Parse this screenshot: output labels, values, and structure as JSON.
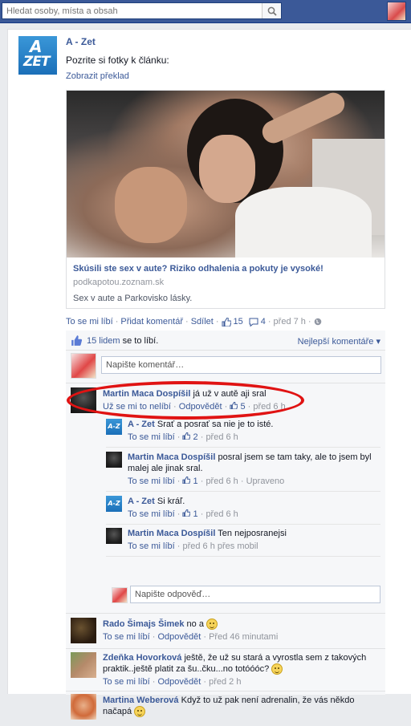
{
  "topbar": {
    "search_placeholder": "Hledat osoby, místa a obsah",
    "search_icon": "search-icon",
    "profile_avatar": "profile-avatar"
  },
  "post": {
    "author": "A - Zet",
    "logo_letter_top": "A",
    "logo_letter_bottom": "ZET",
    "text": "Pozrite si fotky k článku:",
    "translate": "Zobrazit překlad",
    "share": {
      "title": "Skúsili ste sex v aute? Riziko odhalenia a pokuty je vysoké!",
      "domain": "podkapotou.zoznam.sk",
      "description": "Sex v aute a Parkovisko lásky."
    },
    "actions": {
      "like": "To se mi líbí",
      "comment": "Přidat komentář",
      "share": "Sdílet",
      "like_count": "15",
      "comment_count": "4",
      "time": "před 7 h"
    }
  },
  "ufi": {
    "likes_text_link": "15 lidem",
    "likes_text_rest": " se to líbí.",
    "sort": "Nejlepší komentáře ▾",
    "comment_placeholder": "Napište komentář…",
    "reply_placeholder": "Napište odpověď…",
    "comments": [
      {
        "name": "Martin Maca Dospíšil",
        "text": " já už v autě aji sral",
        "meta_unlike": "Už se mi to nelíbí",
        "meta_reply": "Odpovědět",
        "likes": "5",
        "time": "před 6 h",
        "replies": [
          {
            "name": "A - Zet",
            "text": " Srať a posrať sa nie je to isté.",
            "like": "To se mi líbí",
            "likes": "2",
            "time": "před 6 h"
          },
          {
            "name": "Martin Maca Dospíšil",
            "text": " posral jsem se tam taky, ale to jsem byl malej ale jinak sral.",
            "like": "To se mi líbí",
            "likes": "1",
            "time": "před 6 h",
            "extra": "Upraveno"
          },
          {
            "name": "A - Zet",
            "text": " Si kráľ.",
            "like": "To se mi líbí",
            "likes": "1",
            "time": "před 6 h"
          },
          {
            "name": "Martin Maca Dospíšil",
            "text": " Ten nejposranejsi",
            "like": "To se mi líbí",
            "time": "před 6 h přes mobil"
          }
        ]
      },
      {
        "name": "Rado Šimajs Šimek",
        "text": " no a",
        "like": "To se mi líbí",
        "reply": "Odpovědět",
        "time": "Před 46 minutami"
      },
      {
        "name": "Zdeňka Hovorková",
        "text": " ještě, že už su stará a vyrostla sem z takových praktik..ještě platit za šu..čku...no totóóóc?",
        "like": "To se mi líbí",
        "reply": "Odpovědět",
        "time": "před 2 h"
      },
      {
        "name": "Martina Weberová",
        "text": " Když to už pak není adrenalin, že vás někdo načapá"
      }
    ]
  },
  "colors": {
    "brand": "#3b5998",
    "annotation": "#e01313"
  }
}
